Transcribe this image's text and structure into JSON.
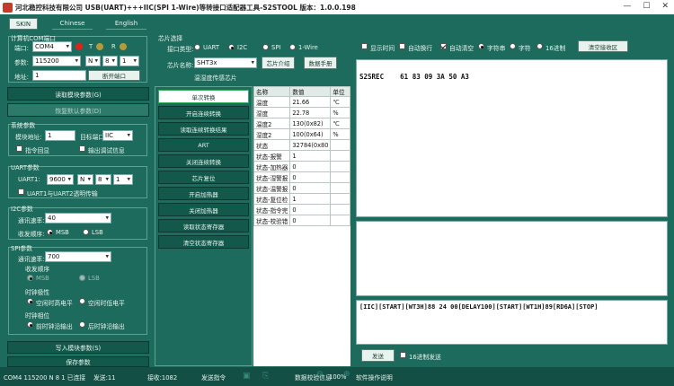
{
  "window": {
    "title": "河北稳控科技有限公司  USB(UART)+++IIC(SPI 1-Wire)等转接口适配器工具-S2STOOL 版本：1.0.0.198"
  },
  "tabs": [
    "SKIN",
    "Chinese",
    "English"
  ],
  "com": {
    "group_title": "计算机COM端口",
    "port_label": "端口:",
    "port_value": "COM4",
    "t_label": "T",
    "r_label": "R",
    "param_label": "参数:",
    "baud": "115200",
    "parity": "N",
    "databits": "8",
    "stopbits": "1",
    "addr_label": "地址:",
    "addr_value": "1",
    "close_btn": "断开端口"
  },
  "left_buttons": {
    "read_params": "读取模块参数(G)",
    "restore_defaults": "恢复默认参数(D)"
  },
  "sys": {
    "group_title": "系统参数",
    "module_addr_label": "模块地址:",
    "module_addr_value": "1",
    "target_label": "目标端口",
    "target_value": "IIC",
    "cmd_echo": "指令回显",
    "debug_info": "输出调试信息"
  },
  "uart": {
    "group_title": "UART参数",
    "uart1_label": "UART1:",
    "baud": "9600",
    "parity": "N",
    "databits": "8",
    "stopbits": "1",
    "passthrough": "UART1与UART2透明传输"
  },
  "i2c": {
    "group_title": "I2C参数",
    "speed_label": "通讯速率:",
    "speed_value": "40",
    "order_label": "收发顺序:",
    "msb": "MSB",
    "lsb": "LSB"
  },
  "spi": {
    "group_title": "SPI参数",
    "speed_label": "通讯速率:",
    "speed_value": "700",
    "order_title": "收发顺序",
    "msb": "MSB",
    "lsb": "LSB",
    "polarity_title": "时钟极性",
    "pol_high": "空闲时高电平",
    "pol_low": "空闲时低电平",
    "phase_title": "时钟相位",
    "phase_first": "前时钟沿输出",
    "phase_second": "后时钟沿输出"
  },
  "bottom_buttons": {
    "write_params": "写入模块参数(S)",
    "save_params": "保存参数"
  },
  "chip": {
    "group_title": "芯片选择",
    "iface_label": "接口类型:",
    "iface_uart": "UART",
    "iface_i2c": "I2C",
    "iface_spi": "SPI",
    "iface_1wire": "1-Wire",
    "name_label": "芯片名称:",
    "name_value": "SHT3x",
    "intro_btn": "芯片介绍",
    "manual_btn": "数据手册",
    "desc": "温湿度传感芯片"
  },
  "commands": [
    "单次转换",
    "开启连续转换",
    "读取连续转换结果",
    "ART",
    "关闭连续转换",
    "芯片复位",
    "开启加热器",
    "关闭加热器",
    "读取状态寄存器",
    "清空状态寄存器"
  ],
  "value_table": {
    "headers": [
      "名称",
      "数值",
      "单位"
    ],
    "rows": [
      [
        "温度",
        "21.66",
        "℃"
      ],
      [
        "湿度",
        "22.78",
        "%"
      ],
      [
        "温度2",
        "130(0x82)",
        "℃"
      ],
      [
        "湿度2",
        "100(0x64)",
        "%"
      ],
      [
        "状态",
        "32784(0x80",
        ""
      ],
      [
        "状态-报警",
        "1",
        ""
      ],
      [
        "状态-加热器",
        "0",
        ""
      ],
      [
        "状态-湿警报",
        "0",
        ""
      ],
      [
        "状态-温警报",
        "0",
        ""
      ],
      [
        "状态-复位检",
        "1",
        ""
      ],
      [
        "状态-指令完",
        "0",
        ""
      ],
      [
        "状态-校验错",
        "0",
        ""
      ]
    ]
  },
  "recv": {
    "show_time": "显示时间",
    "auto_wrap": "自动换行",
    "auto_clear": "自动清空",
    "str_mode": "字符串",
    "char_mode": "字符",
    "hex_mode": "16进制",
    "clear_btn": "清空接收区",
    "content": "S2SREC    61 83 09 3A 50 A3"
  },
  "send": {
    "content": "[IIC][START][WT3H]88 24 00[DELAY100][START][WT1H]89[RD6A][STOP]",
    "send_btn": "发送",
    "hex_send": "16进制发送"
  },
  "status": {
    "port": "COM4 115200 N 8 1 已连接",
    "sent": "发送:11",
    "received": "接收:1082",
    "send_cmd": "发送指令",
    "parse_info": "数据校验信息",
    "zoom": "100%",
    "software_tip": "软件操作说明"
  }
}
